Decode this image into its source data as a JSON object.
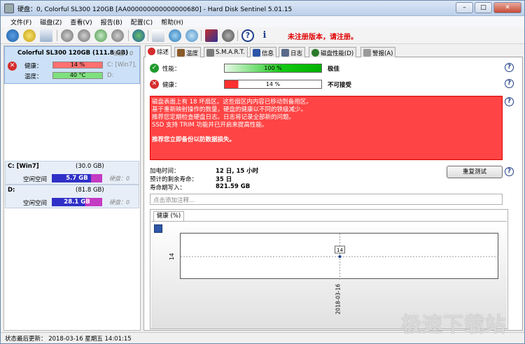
{
  "window": {
    "title": "硬盘：0, Colorful SL300 120GB [AA000000000000000680] - Hard Disk Sentinel 5.01.15",
    "minimize": "–",
    "maximize": "□",
    "close": "✕"
  },
  "menu": [
    "文件(F)",
    "磁盘(Z)",
    "查看(V)",
    "报告(B)",
    "配置(C)",
    "帮助(H)"
  ],
  "toolbar": {
    "unregistered": "未注册版本，请注册。",
    "icons": [
      "refresh-icon",
      "warning-icon",
      "mail-icon",
      "disk-test-icon",
      "disk-test-2-icon",
      "disk-test-3-icon",
      "disk-test-4-icon",
      "globe-icon",
      "report-icon",
      "network-icon",
      "cloud-icon",
      "chart-icon",
      "sound-icon",
      "help-icon",
      "info-icon"
    ]
  },
  "disk": {
    "name": "Colorful SL300 120GB (111.8 GB)",
    "disk_label": "硬盘：0",
    "health_label": "健康：",
    "health_value": "14 %",
    "health_percent": 14,
    "health_volume": "C: [Win7],",
    "temp_label": "温度：",
    "temp_value": "40 °C",
    "temp_volume": "D:"
  },
  "volumes": [
    {
      "name": "C: [Win7]",
      "size": "(30.0 GB)",
      "free_label": "空闲空间",
      "free": "5.7 GB",
      "disk": "硬盘：0"
    },
    {
      "name": "D:",
      "size": "(81.8 GB)",
      "free_label": "空闲空间",
      "free": "28.1 GB",
      "disk": "硬盘：0"
    }
  ],
  "tabs": [
    "综述",
    "温度",
    "S.M.A.R.T.",
    "信息",
    "日志",
    "磁盘性能(D)",
    "警报(A)"
  ],
  "overview": {
    "performance_label": "性能：",
    "performance_value": "100 %",
    "performance_percent": 100,
    "performance_status": "极佳",
    "health_label": "健康：",
    "health_value": "14 %",
    "health_percent": 14,
    "health_status": "不可接受",
    "alert_lines": [
      "磁盘表面上有 18 坏扇区。这些扇区内内容已移动到备用区。",
      "基于重新映射操作的数量，硬盘的健康以不同的铁级减少。",
      "推荐您定期检查硬盘日志。日志将记录全部新的问题。",
      "SSD 支持 TRIM 功能并已开启来提高性能。"
    ],
    "alert_bold": "推荐您立即备份以防数据损失。",
    "power_on_label": "加电时间：",
    "power_on_value": "12 日, 15 小时",
    "remaining_label": "预计的剩余寿命：",
    "remaining_value": "35 日",
    "lifetime_label": "寿命期写入：",
    "lifetime_value": "821.59 GB",
    "retest_button": "重复测试",
    "note_placeholder": "点击添加注释..."
  },
  "chart_panel": {
    "tab_label": "健康 (%)"
  },
  "chart_data": {
    "type": "line",
    "x": [
      "2018-03-16"
    ],
    "series": [
      {
        "values": [
          14
        ]
      }
    ],
    "y_ticks": [
      "14"
    ],
    "x_ticks": [
      "2018-03-16"
    ],
    "data_labels": [
      "14"
    ]
  },
  "status": {
    "text": "状态最后更新： 2018-03-16 星期五 14:01:15"
  },
  "watermark": "极速下载站",
  "colors": {
    "alert_bg": "#fe4444",
    "performance_bar": "#00cc00",
    "health_bar": "#ff5050",
    "selected_disk": "#cce1f7"
  }
}
